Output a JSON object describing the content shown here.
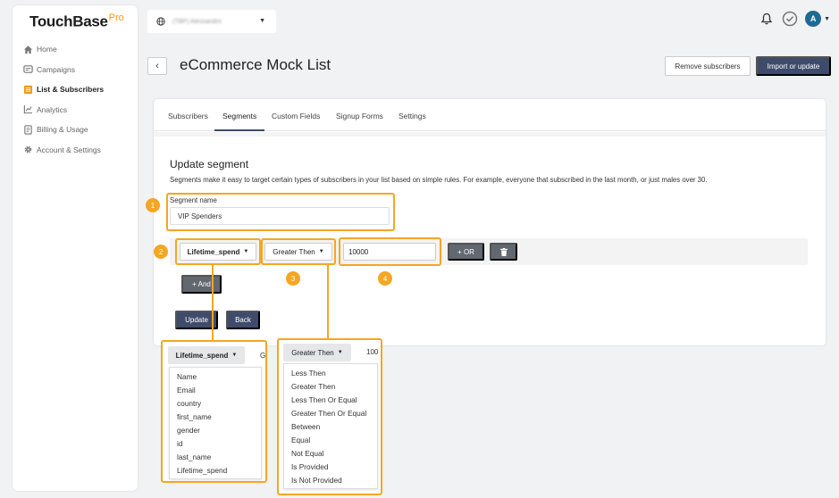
{
  "brand": {
    "name": "TouchBase",
    "suffix": "Pro"
  },
  "sidebar": {
    "items": [
      {
        "label": "Home",
        "icon": "home-icon"
      },
      {
        "label": "Campaigns",
        "icon": "campaigns-icon"
      },
      {
        "label": "List & Subscribers",
        "icon": "list-icon",
        "active": true
      },
      {
        "label": "Analytics",
        "icon": "analytics-icon"
      },
      {
        "label": "Billing & Usage",
        "icon": "billing-icon"
      },
      {
        "label": "Account & Settings",
        "icon": "gear-icon"
      }
    ]
  },
  "topbar": {
    "account_name": "(TBP) Alessandro",
    "avatar_initial": "A"
  },
  "header": {
    "title": "eCommerce Mock List",
    "remove_label": "Remove subscribers",
    "import_label": "Import or update"
  },
  "tabs": [
    {
      "label": "Subscribers"
    },
    {
      "label": "Segments",
      "active": true
    },
    {
      "label": "Custom Fields"
    },
    {
      "label": "Signup Forms"
    },
    {
      "label": "Settings"
    }
  ],
  "segment": {
    "title": "Update segment",
    "description": "Segments make it easy to target certain types of subscribers in your list based on simple rules. For example, everyone that subscribed in the last month, or just males over 30.",
    "name_label": "Segment name",
    "name_value": "VIP Spenders",
    "rule": {
      "field": "Lifetime_spend",
      "operator": "Greater Then",
      "value": "10000"
    },
    "or_label": "+ OR",
    "and_label": "+ And",
    "update_label": "Update",
    "back_label": "Back"
  },
  "annotations": [
    "1",
    "2",
    "3",
    "4"
  ],
  "field_dropdown": {
    "selected": "Lifetime_spend",
    "fragment": "G",
    "options": [
      "Name",
      "Email",
      "country",
      "first_name",
      "gender",
      "id",
      "last_name",
      "Lifetime_spend"
    ]
  },
  "operator_dropdown": {
    "selected": "Greater Then",
    "fragment": "100",
    "options": [
      "Less Then",
      "Greater Then",
      "Less Then Or Equal",
      "Greater Then Or Equal",
      "Between",
      "Equal",
      "Not Equal",
      "Is Provided",
      "Is Not Provided"
    ]
  },
  "colors": {
    "accent": "#f5a623",
    "primary": "#3f4b6b",
    "secondary": "#626870"
  }
}
